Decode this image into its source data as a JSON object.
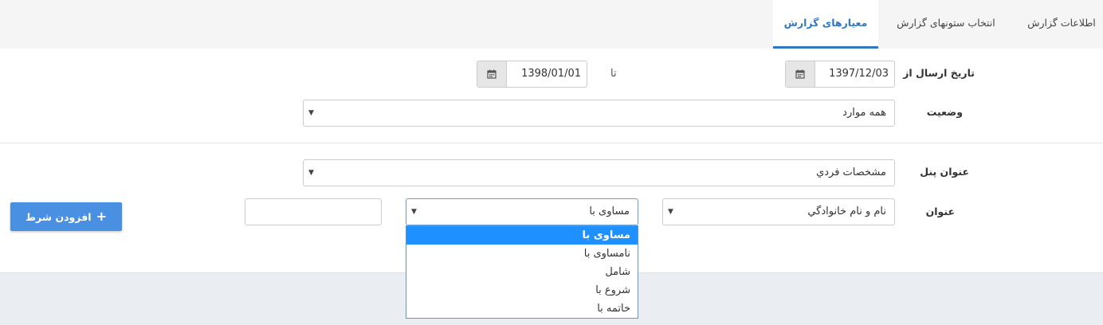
{
  "tabs": [
    {
      "label": "اطلاعات گزارش",
      "active": false
    },
    {
      "label": "انتخاب ستونهای گزارش",
      "active": false
    },
    {
      "label": "معیارهای گزارش",
      "active": true
    }
  ],
  "colors": {
    "accent": "#2f78c4",
    "button": "#4a90e2",
    "selected_option": "#1e90ff",
    "tabbar_bg": "#f5f5f5",
    "footer_bg": "#eaedf1"
  },
  "form": {
    "send_date": {
      "label": "تاریخ ارسال از",
      "from_value": "1397/12/03",
      "to_label": "تا",
      "to_value": "1398/01/01",
      "icon": "calendar-icon"
    },
    "status": {
      "label": "وضعیت",
      "value": "همه موارد"
    },
    "panel_title": {
      "label": "عنوان پنل",
      "value": "مشخصات فردي"
    },
    "condition": {
      "label": "عنوان",
      "field_value": "نام و نام خانوادگي",
      "operator_value": "مساوی با",
      "value": "",
      "operator_options": [
        "مساوی با",
        "نامساوی با",
        "شامل",
        "شروع با",
        "خاتمه با"
      ],
      "selected_index": 0
    }
  },
  "add_condition_button": {
    "label": "افزودن شرط",
    "icon": "plus-icon"
  }
}
